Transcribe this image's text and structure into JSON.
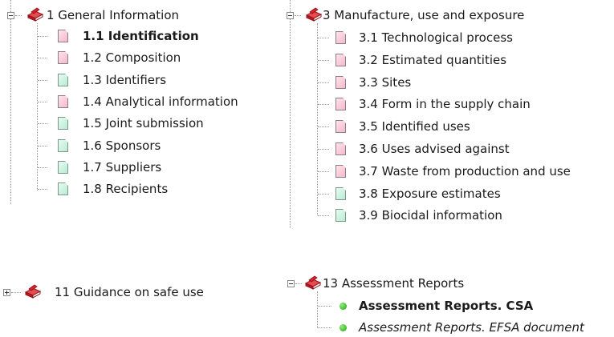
{
  "groups": {
    "g1": {
      "title": "1 General Information",
      "items": [
        {
          "label": "1.1 Identification",
          "style": "bold",
          "icon": "pink-document-icon"
        },
        {
          "label": "1.2 Composition",
          "icon": "pink-document-icon"
        },
        {
          "label": "1.3 Identifiers",
          "icon": "green-document-icon"
        },
        {
          "label": "1.4 Analytical information",
          "icon": "pink-document-icon"
        },
        {
          "label": "1.5 Joint submission",
          "icon": "green-document-icon"
        },
        {
          "label": "1.6 Sponsors",
          "icon": "green-document-icon"
        },
        {
          "label": "1.7 Suppliers",
          "icon": "green-document-icon"
        },
        {
          "label": "1.8 Recipients",
          "icon": "green-document-icon"
        }
      ]
    },
    "g3": {
      "title": "3 Manufacture, use and exposure",
      "items": [
        {
          "label": "3.1 Technological process",
          "icon": "pink-document-icon"
        },
        {
          "label": "3.2 Estimated quantities",
          "icon": "pink-document-icon"
        },
        {
          "label": "3.3 Sites",
          "icon": "pink-document-icon"
        },
        {
          "label": "3.4 Form in the supply chain",
          "icon": "pink-document-icon"
        },
        {
          "label": "3.5 Identified uses",
          "icon": "pink-document-icon"
        },
        {
          "label": "3.6 Uses advised against",
          "icon": "pink-document-icon"
        },
        {
          "label": "3.7 Waste from production and use",
          "icon": "pink-document-icon"
        },
        {
          "label": "3.8 Exposure estimates",
          "icon": "green-document-icon"
        },
        {
          "label": "3.9 Biocidal information",
          "icon": "green-document-icon"
        }
      ]
    },
    "g11": {
      "title": "11 Guidance on safe use"
    },
    "g13": {
      "title": "13 Assessment Reports",
      "items": [
        {
          "label": "Assessment Reports. CSA",
          "style": "bold",
          "icon": "green-dot-icon"
        },
        {
          "label": "Assessment Reports. EFSA document",
          "style": "italic",
          "icon": "green-dot-icon"
        }
      ]
    }
  },
  "colors": {
    "pink_doc": "#f6b9c9",
    "green_doc": "#b7ecd2",
    "book_red": "#d4232d",
    "status_green": "#1f9e12"
  }
}
